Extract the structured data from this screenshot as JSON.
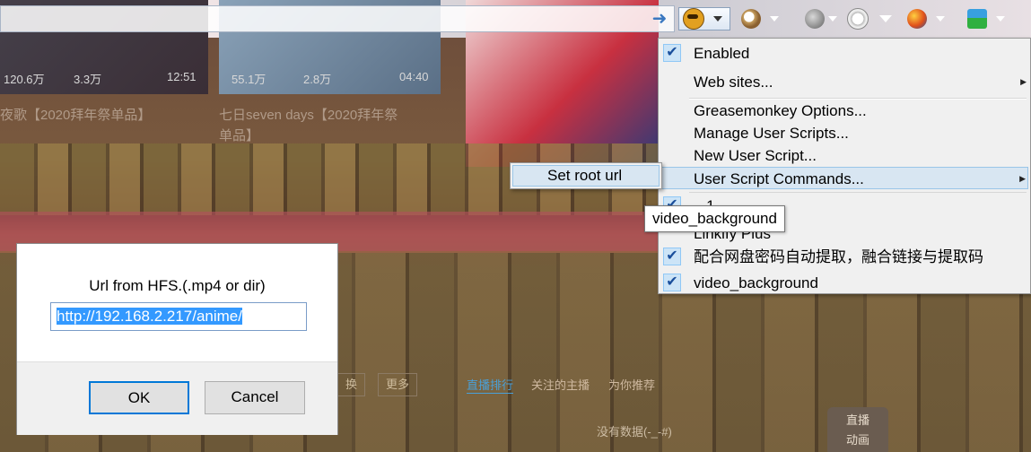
{
  "background": {
    "thumb1_views": "120.6万",
    "thumb1_likes": "3.3万",
    "thumb1_duration": "12:51",
    "thumb2_views": "55.1万",
    "thumb2_likes": "2.8万",
    "thumb2_duration": "04:40",
    "caption_left": "夜歌【2020拜年祭单品】",
    "caption_mid_line1": "七日seven days【2020拜年祭",
    "caption_mid_line2": "单品】",
    "btn_swap": "换",
    "btn_more": "更多",
    "tab_live_rank": "直播排行",
    "tab_following": "关注的主播",
    "tab_recommend": "为你推荐",
    "no_data": "没有数据(-_-#)",
    "live_label_1": "直播",
    "live_label_2": "动画"
  },
  "toolbar": {
    "icons": [
      "go-arrow-icon",
      "greasemonkey-icon",
      "magnifier-icon",
      "gear-globe-icon",
      "palette-icon",
      "firefox-icon",
      "download-icon"
    ]
  },
  "menu": {
    "enabled": "Enabled",
    "web_sites": "Web sites...",
    "options": "Greasemonkey Options...",
    "manage": "Manage User Scripts...",
    "new_script": "New User Script...",
    "commands": "User Script Commands...",
    "partial_item": "...1",
    "linkify": "Linkify Plus",
    "baidu_pan": "配合网盘密码自动提取，融合链接与提取码",
    "video_bg": "video_background"
  },
  "submenu": {
    "set_root": "Set root url"
  },
  "tooltip": {
    "text": "video_background"
  },
  "dialog": {
    "prompt": "Url from HFS.(.mp4 or dir)",
    "input_value": "http://192.168.2.217/anime/",
    "ok": "OK",
    "cancel": "Cancel"
  },
  "colors": {
    "selection": "#3399ff",
    "menu_bg": "#f0f0f0",
    "hover": "#d8e6f2",
    "check_blue": "#1a4f9c"
  }
}
